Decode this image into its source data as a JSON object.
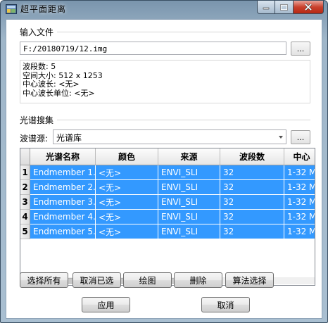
{
  "window": {
    "title": "超平面距离",
    "icon": "app-icon",
    "controls": [
      "minimize-icon",
      "maximize-icon",
      "close-icon"
    ]
  },
  "input_group": {
    "title": "输入文件",
    "file_path": "F:/20180719/12.img",
    "browse_label": "...",
    "info": [
      "波段数: 5",
      "空间大小: 512 x 1253",
      "中心波长: <无>",
      "中心波长单位: <无>"
    ]
  },
  "spectral_group": {
    "title": "光谱搜集",
    "source_label": "波谱源:",
    "source_value": "光谱库",
    "browse_label": "...",
    "table": {
      "columns": [
        "光谱名称",
        "颜色",
        "来源",
        "波段数",
        "中心"
      ],
      "rows": [
        {
          "num": "1",
          "name": "Endmember 1...",
          "color": "<无>",
          "source": "ENVI_SLI",
          "bands": "32",
          "center": "1-32 M"
        },
        {
          "num": "2",
          "name": "Endmember 2...",
          "color": "<无>",
          "source": "ENVI_SLI",
          "bands": "32",
          "center": "1-32 M"
        },
        {
          "num": "3",
          "name": "Endmember 3...",
          "color": "<无>",
          "source": "ENVI_SLI",
          "bands": "32",
          "center": "1-32 M"
        },
        {
          "num": "4",
          "name": "Endmember 4...",
          "color": "<无>",
          "source": "ENVI_SLI",
          "bands": "32",
          "center": "1-32 M"
        },
        {
          "num": "5",
          "name": "Endmember 5...",
          "color": "<无>",
          "source": "ENVI_SLI",
          "bands": "32",
          "center": "1-32 M"
        }
      ]
    },
    "buttons": {
      "select_all": "选择所有",
      "deselect": "取消已选",
      "plot": "绘图",
      "delete": "删除",
      "algorithm": "算法选择"
    }
  },
  "footer": {
    "apply": "应用",
    "cancel": "取消"
  },
  "colors": {
    "selection": "#3399ff",
    "title_gradient": "#9fb6c9"
  }
}
